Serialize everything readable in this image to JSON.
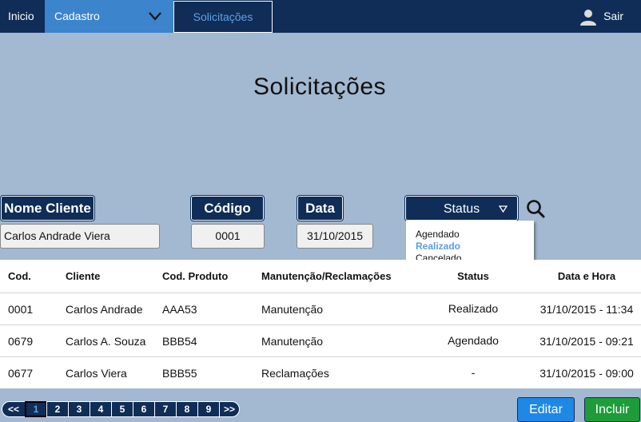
{
  "nav": {
    "inicio": "Inicio",
    "cadastro": "Cadastro",
    "solicitacoes": "Solicitações",
    "sair": "Sair"
  },
  "page": {
    "title": "Solicitações"
  },
  "filters": {
    "nome_label": "Nome Cliente",
    "nome_value": "Carlos Andrade Viera",
    "codigo_label": "Código",
    "codigo_value": "0001",
    "data_label": "Data",
    "data_value": "31/10/2015",
    "status_label": "Status",
    "status_options": [
      "Agendado",
      "Realizado",
      "Cancelado"
    ],
    "status_selected": "Realizado"
  },
  "table": {
    "headers": [
      "Cod.",
      "Cliente",
      "Cod. Produto",
      "Manutenção/Reclamações",
      "Status",
      "Data e Hora"
    ],
    "rows": [
      [
        "0001",
        "Carlos Andrade",
        "AAA53",
        "Manutenção",
        "Realizado",
        "31/10/2015 - 11:34"
      ],
      [
        "0679",
        "Carlos A. Souza",
        "BBB54",
        "Manutenção",
        "Agendado",
        "31/10/2015 - 09:21"
      ],
      [
        "0677",
        "Carlos Viera",
        "BBB55",
        "Reclamações",
        "-",
        "31/10/2015 - 09:00"
      ]
    ]
  },
  "pagination": {
    "prev": "<<",
    "pages": [
      "1",
      "2",
      "3",
      "4",
      "5",
      "6",
      "7",
      "8",
      "9"
    ],
    "next": ">>",
    "current": "1"
  },
  "actions": {
    "editar": "Editar",
    "incluir": "Incluir"
  },
  "colors": {
    "nav_bg": "#0f2d57",
    "nav_active": "#3c84cc",
    "page_bg": "#a3b8d1",
    "edit_button": "#1e88e5",
    "include_button": "#1e9c3a"
  },
  "icons": [
    "chevron-down-icon",
    "user-icon",
    "caret-down-icon",
    "search-icon"
  ]
}
